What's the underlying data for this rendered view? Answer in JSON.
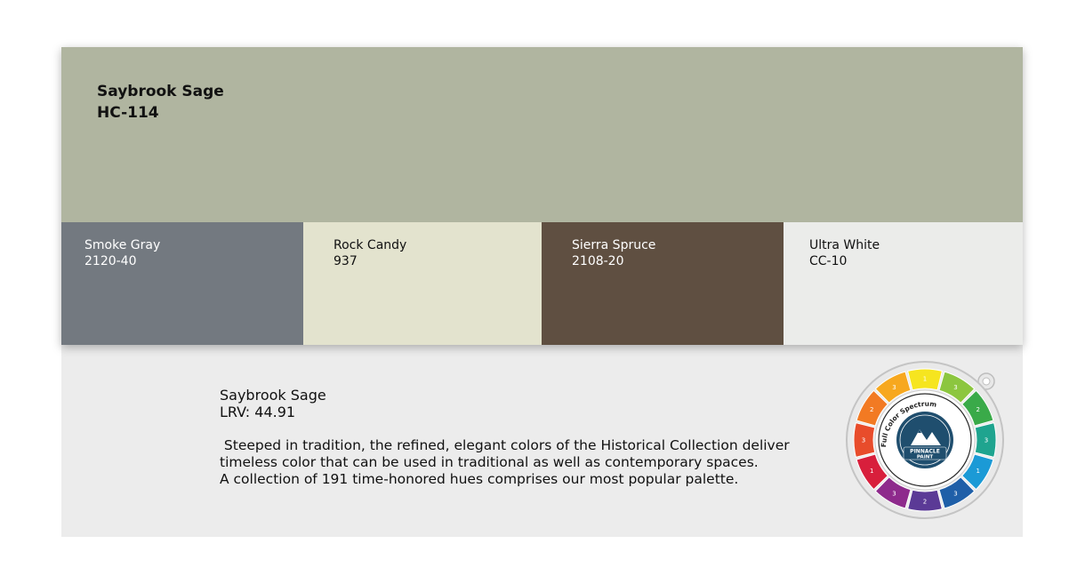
{
  "main_color": {
    "name": "Saybrook Sage",
    "code": "HC-114",
    "hex": "#b0b5a0"
  },
  "swatches": [
    {
      "name": "Smoke Gray",
      "code": "2120-40",
      "hex": "#737980"
    },
    {
      "name": "Rock Candy",
      "code": "937",
      "hex": "#e3e3ce"
    },
    {
      "name": "Sierra Spruce",
      "code": "2108-20",
      "hex": "#5f4f41"
    },
    {
      "name": "Ultra White",
      "code": "CC-10",
      "hex": "#ebecea"
    }
  ],
  "info": {
    "name": "Saybrook Sage",
    "lrv": "LRV: 44.91",
    "description_lines": [
      " Steeped in tradition, the refined, elegant colors of the Historical Collection deliver",
      "timeless color that can be used in traditional as well as contemporary spaces.",
      "A collection of 191 time-honored hues comprises our most popular palette."
    ]
  },
  "color_wheel": {
    "ring_text": "Full Color Spectrum",
    "logo_line1": "PINNACLE",
    "logo_line2": "PAINT"
  }
}
